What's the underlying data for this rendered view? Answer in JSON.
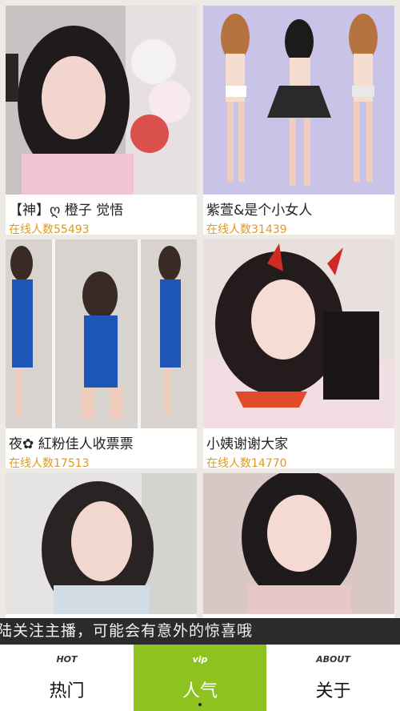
{
  "streams": [
    {
      "name": "【神】ღ 橙子 觉悟",
      "online": "在线人数55493"
    },
    {
      "name": "紫萱&是个小女人",
      "online": "在线人数31439"
    },
    {
      "name": "夜✿ 紅粉佳人收票票",
      "online": "在线人数17513"
    },
    {
      "name": "小姨谢谢大家",
      "online": "在线人数14770"
    }
  ],
  "ticker": "陆关注主播，可能会有意外的惊喜哦",
  "tabs": [
    {
      "en": "HOT",
      "zh": "热门",
      "active": false
    },
    {
      "en": "vip",
      "zh": "人气",
      "active": true
    },
    {
      "en": "ABOUT",
      "zh": "关于",
      "active": false
    }
  ],
  "colors": {
    "accent": "#8dc21f",
    "online_count": "#e0991c",
    "ticker_bg": "#2b2b2b"
  }
}
